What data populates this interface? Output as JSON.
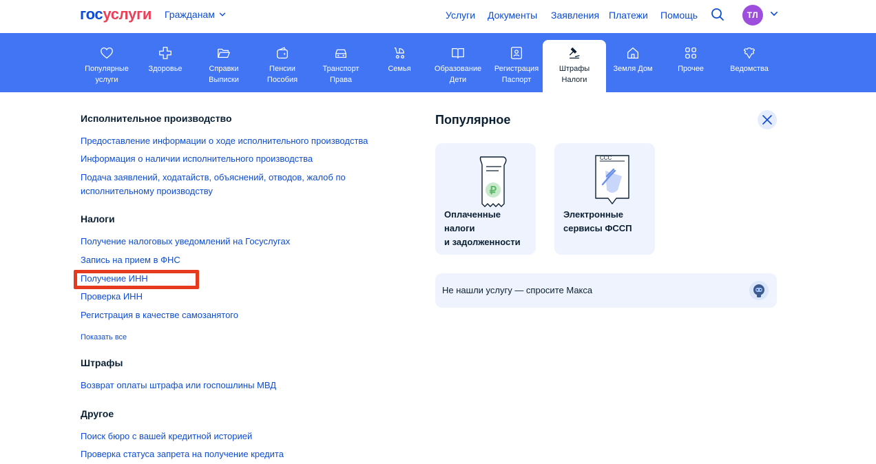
{
  "header": {
    "logo_left": "гос",
    "logo_right": "услуги",
    "audience": "Гражданам",
    "nav": [
      "Услуги",
      "Документы",
      "Заявления",
      "Платежи",
      "Помощь"
    ],
    "avatar_initials": "ТЛ"
  },
  "categories": [
    {
      "line1": "Популярные",
      "line2": "услуги",
      "icon": "heart-icon"
    },
    {
      "line1": "Здоровье",
      "line2": "",
      "icon": "medical-cross-icon"
    },
    {
      "line1": "Справки",
      "line2": "Выписки",
      "icon": "folder-icon"
    },
    {
      "line1": "Пенсии",
      "line2": "Пособия",
      "icon": "wallet-icon"
    },
    {
      "line1": "Транспорт",
      "line2": "Права",
      "icon": "car-icon"
    },
    {
      "line1": "Семья",
      "line2": "",
      "icon": "stroller-icon"
    },
    {
      "line1": "Образование",
      "line2": "Дети",
      "icon": "book-icon"
    },
    {
      "line1": "Регистрация",
      "line2": "Паспорт",
      "icon": "id-card-icon"
    },
    {
      "line1": "Штрафы",
      "line2": "Налоги",
      "icon": "gavel-icon"
    },
    {
      "line1": "Земля Дом",
      "line2": "",
      "icon": "house-icon"
    },
    {
      "line1": "Прочее",
      "line2": "",
      "icon": "grid-icon"
    },
    {
      "line1": "Ведомства",
      "line2": "",
      "icon": "emblem-icon"
    }
  ],
  "sections": {
    "enforcement": {
      "title": "Исполнительное производство",
      "links": [
        "Предоставление информации о ходе исполнительного производства",
        "Информация о наличии исполнительного производства",
        "Подача заявлений, ходатайств, объяснений, отводов, жалоб по",
        "исполнительному производству"
      ]
    },
    "taxes": {
      "title": "Налоги",
      "links": [
        "Получение налоговых уведомлений на Госуслугах",
        "Запись на прием в ФНС",
        "Получение ИНН",
        "Проверка ИНН",
        "Регистрация в качестве самозанятого"
      ],
      "show_all": "Показать все"
    },
    "fines": {
      "title": "Штрафы",
      "links": [
        "Возврат оплаты штрафа или госпошлины МВД"
      ]
    },
    "other": {
      "title": "Другое",
      "links": [
        "Поиск бюро с вашей кредитной историей",
        "Проверка статуса запрета на получение кредита"
      ]
    }
  },
  "popular": {
    "title": "Популярное",
    "cards": [
      {
        "line1": "Оплаченные",
        "line2": "налоги",
        "line3": "и задолженности",
        "icon": "receipt-ruble-icon"
      },
      {
        "line1": "Электронные",
        "line2": "сервисы ФССП",
        "line3": "",
        "icon": "document-gavel-icon"
      }
    ],
    "ask": "Не нашли услугу — спросите Макса"
  },
  "colors": {
    "primary": "#0d4cd3",
    "category_bar": "#4275f4",
    "highlight": "#e53a1e",
    "avatar": "#9d4edd"
  }
}
